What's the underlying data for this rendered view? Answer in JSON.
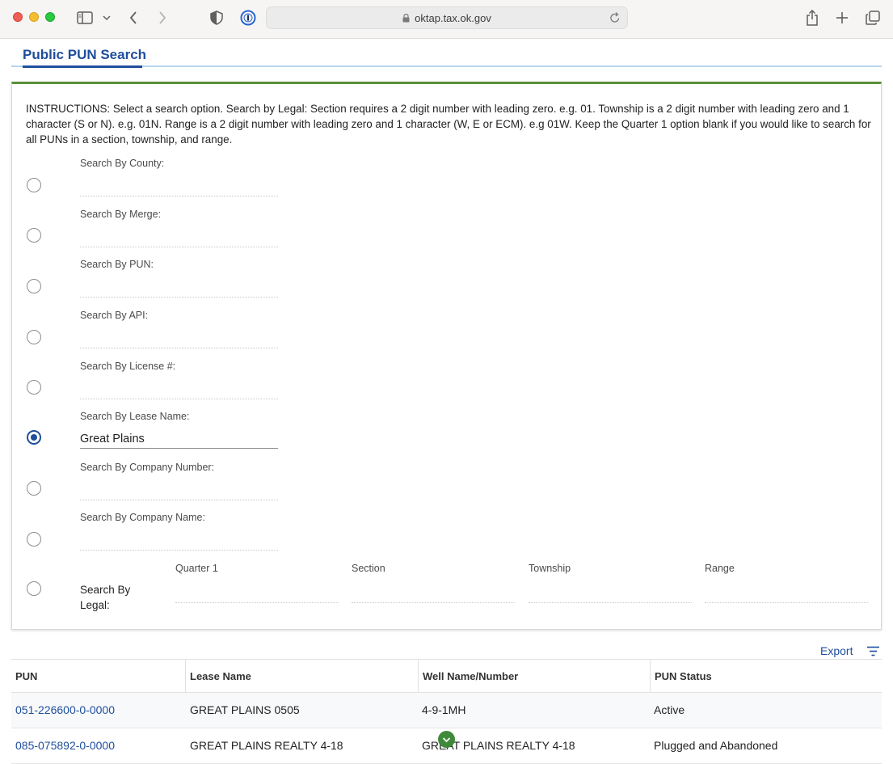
{
  "browser": {
    "url": "oktap.tax.ok.gov"
  },
  "page": {
    "tab_title": "Public PUN Search",
    "instructions": "INSTRUCTIONS: Select a search option. Search by Legal: Section requires a 2 digit number with leading zero. e.g. 01. Township is a 2 digit number with leading zero and 1 character (S or N). e.g. 01N. Range is a 2 digit number with leading zero and 1 character (W, E or ECM). e.g 01W. Keep the Quarter 1 option blank if you would like to search for all PUNs in a section, township, and range."
  },
  "search_options": [
    {
      "label": "Search By County:",
      "value": "",
      "selected": false
    },
    {
      "label": "Search By Merge:",
      "value": "",
      "selected": false
    },
    {
      "label": "Search By PUN:",
      "value": "",
      "selected": false
    },
    {
      "label": "Search By API:",
      "value": "",
      "selected": false
    },
    {
      "label": "Search By License #:",
      "value": "",
      "selected": false
    },
    {
      "label": "Search By Lease Name:",
      "value": "Great Plains",
      "selected": true
    },
    {
      "label": "Search By Company Number:",
      "value": "",
      "selected": false
    },
    {
      "label": "Search By Company Name:",
      "value": "",
      "selected": false
    }
  ],
  "legal": {
    "label": "Search By Legal:",
    "columns": [
      "Quarter 1",
      "Section",
      "Township",
      "Range"
    ]
  },
  "results": {
    "export_label": "Export",
    "headers": [
      "PUN",
      "Lease Name",
      "Well Name/Number",
      "PUN Status"
    ],
    "rows": [
      [
        "051-226600-0-0000",
        "GREAT PLAINS 0505",
        "4-9-1MH",
        "Active"
      ],
      [
        "085-075892-0-0000",
        "GREAT PLAINS REALTY 4-18",
        "GREAT PLAINS REALTY 4-18",
        "Plugged and Abandoned"
      ]
    ]
  },
  "colors": {
    "brand_blue": "#1f4e9c",
    "accent_green": "#5b8f3a"
  }
}
